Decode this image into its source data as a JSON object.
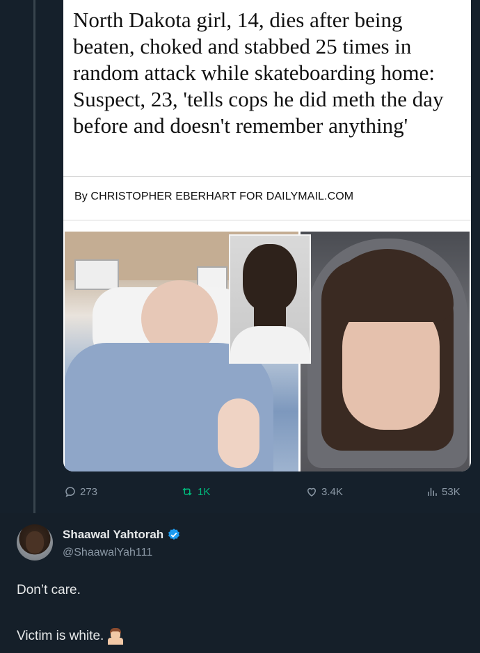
{
  "article": {
    "headline": "North Dakota girl, 14, dies after being beaten, choked and stabbed 25 times in random attack while skateboarding home: Suspect, 23, 'tells cops he did meth the day before and doesn't remember anything'",
    "byline": "By CHRISTOPHER EBERHART FOR DAILYMAIL.COM"
  },
  "images": {
    "left": "hospital-bed-photo",
    "inset": "suspect-mugshot-photo",
    "right": "victim-portrait-photo"
  },
  "stats": {
    "replies": "273",
    "retweets": "1K",
    "likes": "3.4K",
    "views": "53K",
    "retweet_color": "#00ba7c",
    "muted_color": "#8b98a5"
  },
  "reply": {
    "name": "Shaawal Yahtorah",
    "handle": "@ShaawalYah111",
    "verified_color": "#1d9bf0",
    "line1": "Don’t care.",
    "line2": "Victim is white.",
    "emoji": "person-shrugging-emoji"
  }
}
